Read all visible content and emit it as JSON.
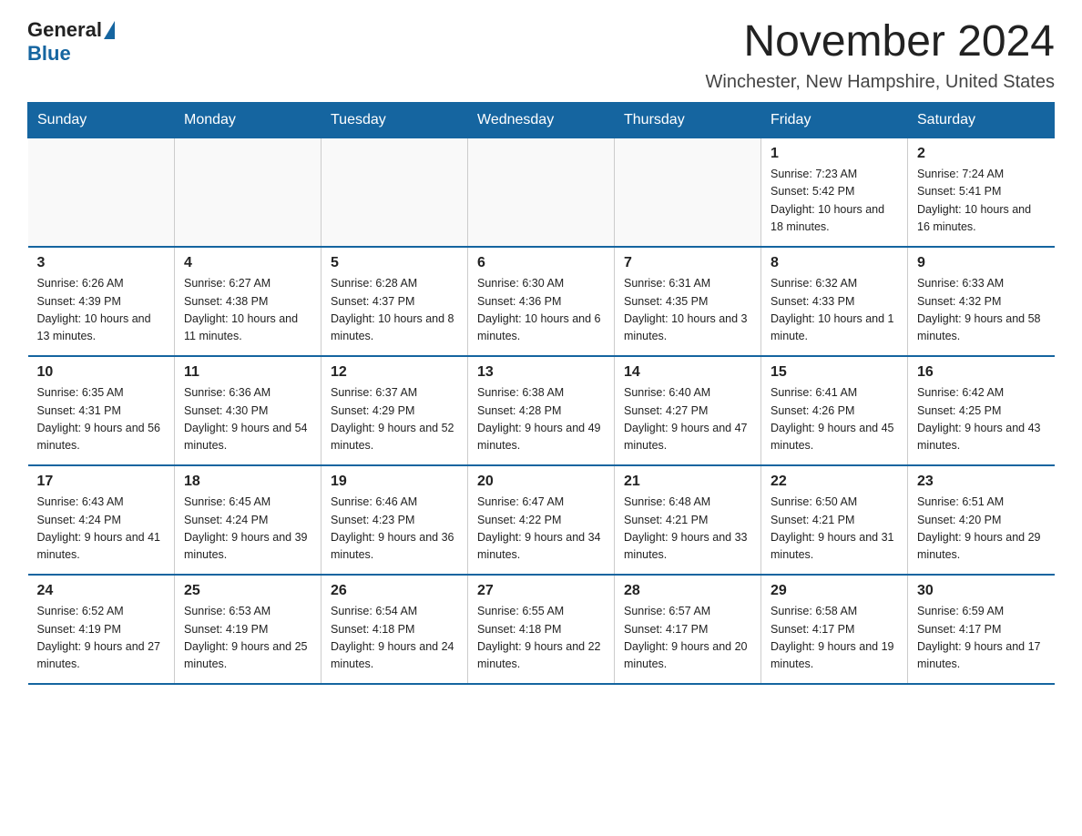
{
  "logo": {
    "text_general": "General",
    "text_blue": "Blue"
  },
  "title": {
    "month_year": "November 2024",
    "location": "Winchester, New Hampshire, United States"
  },
  "days_of_week": [
    "Sunday",
    "Monday",
    "Tuesday",
    "Wednesday",
    "Thursday",
    "Friday",
    "Saturday"
  ],
  "weeks": [
    [
      {
        "day": "",
        "info": ""
      },
      {
        "day": "",
        "info": ""
      },
      {
        "day": "",
        "info": ""
      },
      {
        "day": "",
        "info": ""
      },
      {
        "day": "",
        "info": ""
      },
      {
        "day": "1",
        "info": "Sunrise: 7:23 AM\nSunset: 5:42 PM\nDaylight: 10 hours and 18 minutes."
      },
      {
        "day": "2",
        "info": "Sunrise: 7:24 AM\nSunset: 5:41 PM\nDaylight: 10 hours and 16 minutes."
      }
    ],
    [
      {
        "day": "3",
        "info": "Sunrise: 6:26 AM\nSunset: 4:39 PM\nDaylight: 10 hours and 13 minutes."
      },
      {
        "day": "4",
        "info": "Sunrise: 6:27 AM\nSunset: 4:38 PM\nDaylight: 10 hours and 11 minutes."
      },
      {
        "day": "5",
        "info": "Sunrise: 6:28 AM\nSunset: 4:37 PM\nDaylight: 10 hours and 8 minutes."
      },
      {
        "day": "6",
        "info": "Sunrise: 6:30 AM\nSunset: 4:36 PM\nDaylight: 10 hours and 6 minutes."
      },
      {
        "day": "7",
        "info": "Sunrise: 6:31 AM\nSunset: 4:35 PM\nDaylight: 10 hours and 3 minutes."
      },
      {
        "day": "8",
        "info": "Sunrise: 6:32 AM\nSunset: 4:33 PM\nDaylight: 10 hours and 1 minute."
      },
      {
        "day": "9",
        "info": "Sunrise: 6:33 AM\nSunset: 4:32 PM\nDaylight: 9 hours and 58 minutes."
      }
    ],
    [
      {
        "day": "10",
        "info": "Sunrise: 6:35 AM\nSunset: 4:31 PM\nDaylight: 9 hours and 56 minutes."
      },
      {
        "day": "11",
        "info": "Sunrise: 6:36 AM\nSunset: 4:30 PM\nDaylight: 9 hours and 54 minutes."
      },
      {
        "day": "12",
        "info": "Sunrise: 6:37 AM\nSunset: 4:29 PM\nDaylight: 9 hours and 52 minutes."
      },
      {
        "day": "13",
        "info": "Sunrise: 6:38 AM\nSunset: 4:28 PM\nDaylight: 9 hours and 49 minutes."
      },
      {
        "day": "14",
        "info": "Sunrise: 6:40 AM\nSunset: 4:27 PM\nDaylight: 9 hours and 47 minutes."
      },
      {
        "day": "15",
        "info": "Sunrise: 6:41 AM\nSunset: 4:26 PM\nDaylight: 9 hours and 45 minutes."
      },
      {
        "day": "16",
        "info": "Sunrise: 6:42 AM\nSunset: 4:25 PM\nDaylight: 9 hours and 43 minutes."
      }
    ],
    [
      {
        "day": "17",
        "info": "Sunrise: 6:43 AM\nSunset: 4:24 PM\nDaylight: 9 hours and 41 minutes."
      },
      {
        "day": "18",
        "info": "Sunrise: 6:45 AM\nSunset: 4:24 PM\nDaylight: 9 hours and 39 minutes."
      },
      {
        "day": "19",
        "info": "Sunrise: 6:46 AM\nSunset: 4:23 PM\nDaylight: 9 hours and 36 minutes."
      },
      {
        "day": "20",
        "info": "Sunrise: 6:47 AM\nSunset: 4:22 PM\nDaylight: 9 hours and 34 minutes."
      },
      {
        "day": "21",
        "info": "Sunrise: 6:48 AM\nSunset: 4:21 PM\nDaylight: 9 hours and 33 minutes."
      },
      {
        "day": "22",
        "info": "Sunrise: 6:50 AM\nSunset: 4:21 PM\nDaylight: 9 hours and 31 minutes."
      },
      {
        "day": "23",
        "info": "Sunrise: 6:51 AM\nSunset: 4:20 PM\nDaylight: 9 hours and 29 minutes."
      }
    ],
    [
      {
        "day": "24",
        "info": "Sunrise: 6:52 AM\nSunset: 4:19 PM\nDaylight: 9 hours and 27 minutes."
      },
      {
        "day": "25",
        "info": "Sunrise: 6:53 AM\nSunset: 4:19 PM\nDaylight: 9 hours and 25 minutes."
      },
      {
        "day": "26",
        "info": "Sunrise: 6:54 AM\nSunset: 4:18 PM\nDaylight: 9 hours and 24 minutes."
      },
      {
        "day": "27",
        "info": "Sunrise: 6:55 AM\nSunset: 4:18 PM\nDaylight: 9 hours and 22 minutes."
      },
      {
        "day": "28",
        "info": "Sunrise: 6:57 AM\nSunset: 4:17 PM\nDaylight: 9 hours and 20 minutes."
      },
      {
        "day": "29",
        "info": "Sunrise: 6:58 AM\nSunset: 4:17 PM\nDaylight: 9 hours and 19 minutes."
      },
      {
        "day": "30",
        "info": "Sunrise: 6:59 AM\nSunset: 4:17 PM\nDaylight: 9 hours and 17 minutes."
      }
    ]
  ]
}
